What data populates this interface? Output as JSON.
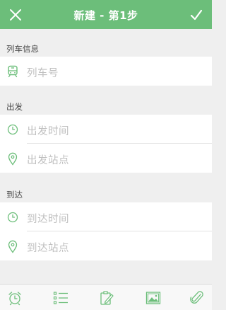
{
  "header": {
    "title": "新建 - 第1步",
    "close_icon": "close-icon",
    "confirm_icon": "checkmark-icon"
  },
  "sections": {
    "train": {
      "title": "列车信息",
      "fields": [
        {
          "placeholder": "列车号",
          "icon": "train-icon"
        }
      ]
    },
    "departure": {
      "title": "出发",
      "fields": [
        {
          "placeholder": "出发时间",
          "icon": "clock-icon"
        },
        {
          "placeholder": "出发站点",
          "icon": "location-pin-icon"
        }
      ]
    },
    "arrival": {
      "title": "到达",
      "fields": [
        {
          "placeholder": "到达时间",
          "icon": "clock-icon"
        },
        {
          "placeholder": "到达站点",
          "icon": "location-pin-icon"
        }
      ]
    }
  },
  "tabbar": {
    "items": [
      "alarm-clock-icon",
      "list-icon",
      "edit-note-icon",
      "image-icon",
      "paperclip-icon"
    ]
  },
  "colors": {
    "accent": "#6cbe7a",
    "background": "#efefef",
    "placeholder": "#bfbfbf"
  }
}
